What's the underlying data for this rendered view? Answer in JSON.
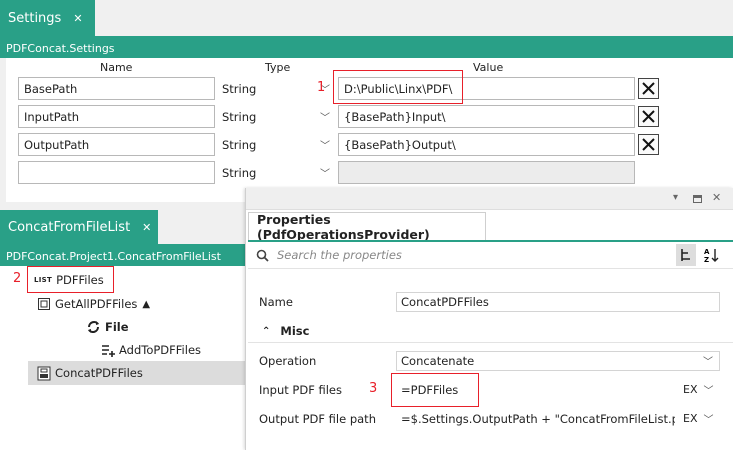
{
  "settings_panel": {
    "tab_label": "Settings",
    "section_title": "PDFConcat.Settings",
    "columns": {
      "name": "Name",
      "type": "Type",
      "value": "Value"
    },
    "rows": [
      {
        "name": "BasePath",
        "type": "String",
        "value": "D:\\Public\\Linx\\PDF\\"
      },
      {
        "name": "InputPath",
        "type": "String",
        "value": "{BasePath}Input\\"
      },
      {
        "name": "OutputPath",
        "type": "String",
        "value": "{BasePath}Output\\"
      },
      {
        "name": "",
        "type": "String",
        "value": ""
      }
    ],
    "marker": "1"
  },
  "process_panel": {
    "tab_label": "ConcatFromFileList",
    "path": "PDFConcat.Project1.ConcatFromFileList",
    "marker": "2",
    "tree": {
      "list_item": {
        "badge": "LIST",
        "label": "PDFFiles"
      },
      "get_files": {
        "label": "GetAllPDFFiles",
        "arrow": "▲"
      },
      "loop": {
        "label": "File"
      },
      "add_to": {
        "label": "AddToPDFFiles"
      },
      "concat": {
        "label": "ConcatPDFFiles"
      }
    }
  },
  "properties_panel": {
    "title": "Properties (PdfOperationsProvider)",
    "search_placeholder": "Search the properties",
    "section_misc": "Misc",
    "marker": "3",
    "props": {
      "name": {
        "label": "Name",
        "value": "ConcatPDFFiles"
      },
      "operation": {
        "label": "Operation",
        "value": "Concatenate"
      },
      "input_files": {
        "label": "Input PDF files",
        "value": "=PDFFiles",
        "ex": "EX"
      },
      "output_path": {
        "label": "Output PDF file path",
        "value": "=$.Settings.OutputPath + \"ConcatFromFileList.pdf\"",
        "ex": "EX"
      }
    }
  },
  "colors": {
    "accent": "#29a087",
    "highlight": "#e8202a"
  }
}
